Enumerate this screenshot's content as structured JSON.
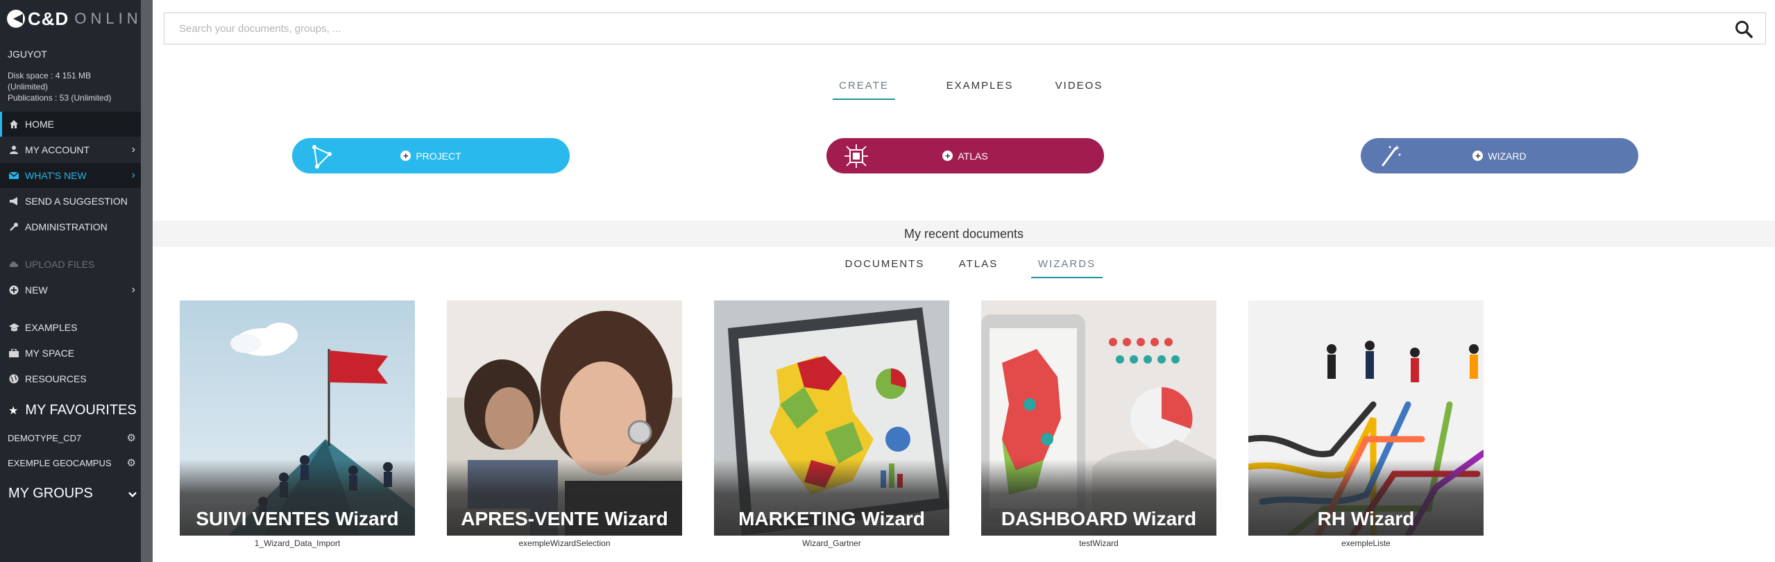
{
  "app": {
    "logo_text": "C&D",
    "logo_sub": "ONLINE"
  },
  "sidebar": {
    "user": "JGUYOT",
    "disk_space": "Disk space : 4 151 MB",
    "disk_unlimited": "(Unlimited)",
    "publications": "Publications : 53 (Unlimited)",
    "items": [
      {
        "label": "HOME",
        "icon": "home-icon"
      },
      {
        "label": "MY ACCOUNT",
        "icon": "user-icon"
      },
      {
        "label": "WHAT'S NEW",
        "icon": "envelope-icon"
      },
      {
        "label": "SEND A SUGGESTION",
        "icon": "megaphone-icon"
      },
      {
        "label": "ADMINISTRATION",
        "icon": "wrench-icon"
      },
      {
        "label": "UPLOAD FILES",
        "icon": "cloud-upload-icon"
      },
      {
        "label": "NEW",
        "icon": "plus-circle-icon"
      },
      {
        "label": "EXAMPLES",
        "icon": "graduation-icon"
      },
      {
        "label": "MY SPACE",
        "icon": "briefcase-icon"
      },
      {
        "label": "RESOURCES",
        "icon": "globe-icon"
      }
    ],
    "favourites_title": "MY FAVOURITES",
    "favourites": [
      {
        "label": "DEMOTYPE_CD7"
      },
      {
        "label": "EXEMPLE GEOCAMPUS"
      }
    ],
    "groups_title": "MY GROUPS"
  },
  "search": {
    "placeholder": "Search your documents, groups, ..."
  },
  "create_tabs": [
    {
      "label": "CREATE",
      "active": true
    },
    {
      "label": "EXAMPLES",
      "active": false
    },
    {
      "label": "VIDEOS",
      "active": false
    }
  ],
  "create_buttons": [
    {
      "label": "PROJECT",
      "color": "#29b9ec"
    },
    {
      "label": "ATLAS",
      "color": "#a21d4f"
    },
    {
      "label": "WIZARD",
      "color": "#5c78b0"
    }
  ],
  "recent": {
    "title": "My recent documents",
    "tabs": [
      {
        "label": "DOCUMENTS",
        "active": false
      },
      {
        "label": "ATLAS",
        "active": false
      },
      {
        "label": "WIZARDS",
        "active": true
      }
    ],
    "cards": [
      {
        "title": "SUIVI VENTES Wizard",
        "file": "1_Wizard_Data_Import"
      },
      {
        "title": "APRES-VENTE Wizard",
        "file": "exempleWizardSelection"
      },
      {
        "title": "MARKETING Wizard",
        "file": "Wizard_Gartner"
      },
      {
        "title": "DASHBOARD Wizard",
        "file": "testWizard"
      },
      {
        "title": "RH Wizard",
        "file": "exempleListe"
      }
    ]
  },
  "colors": {
    "sidebar_bg": "#22272e",
    "accent_blue": "#29b4ec",
    "tab_underline": "#1f95a3"
  }
}
